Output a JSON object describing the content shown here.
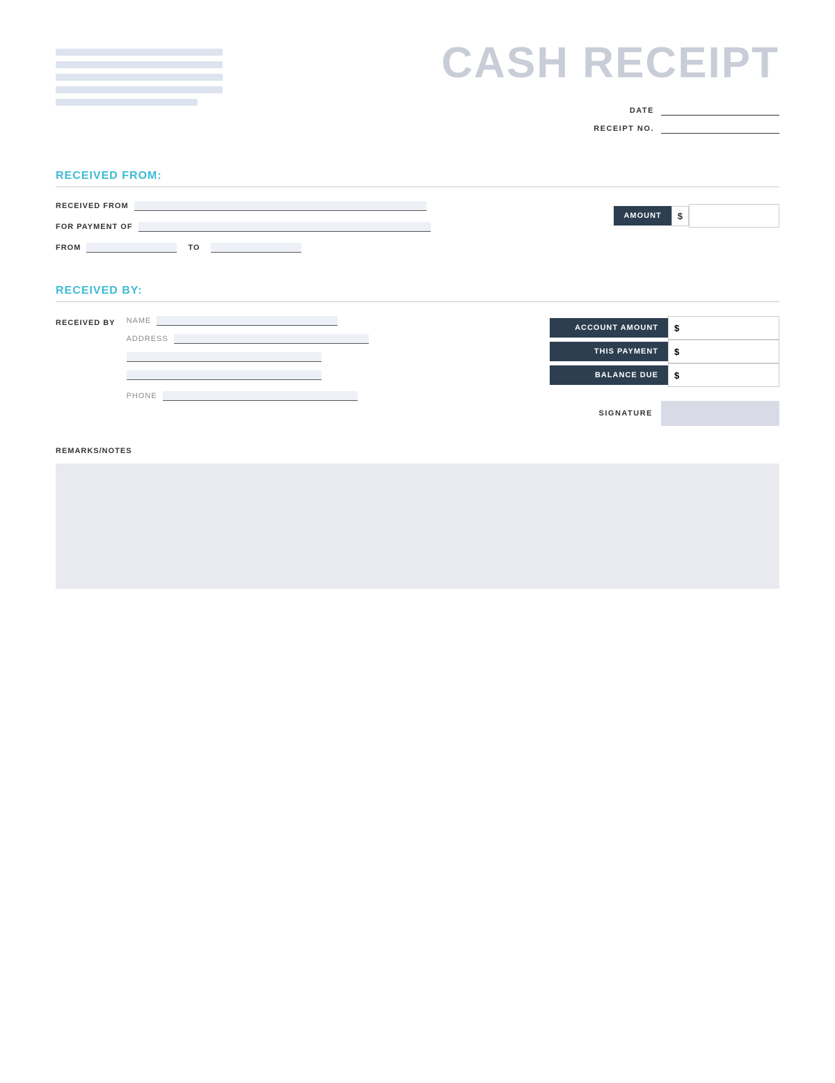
{
  "header": {
    "title": "CASH RECEIPT",
    "date_label": "DATE",
    "receipt_no_label": "RECEIPT NO."
  },
  "received_from_section": {
    "heading": "RECEIVED FROM:",
    "received_from_label": "RECEIVED FROM",
    "for_payment_of_label": "FOR PAYMENT OF",
    "from_label": "FROM",
    "to_label": "TO",
    "amount_label": "AMOUNT",
    "dollar_sign": "$"
  },
  "received_by_section": {
    "heading": "RECEIVED BY:",
    "received_by_label": "RECEIVED BY",
    "name_label": "NAME",
    "address_label": "ADDRESS",
    "phone_label": "PHONE",
    "account_amount_label": "ACCOUNT AMOUNT",
    "this_payment_label": "THIS PAYMENT",
    "balance_due_label": "BALANCE DUE",
    "dollar_sign": "$",
    "signature_label": "SIGNATURE"
  },
  "remarks_section": {
    "label": "REMARKS/NOTES"
  }
}
